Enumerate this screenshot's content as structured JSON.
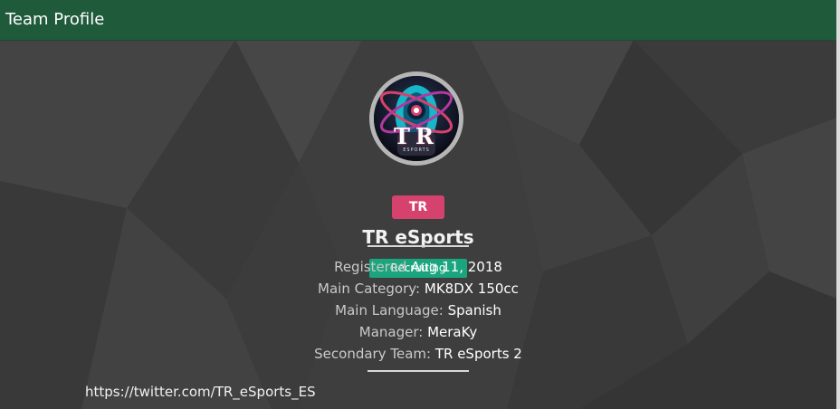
{
  "header": {
    "title": "Team Profile"
  },
  "team": {
    "tag": "TR",
    "name": "TR eSports",
    "status": "Recruiting",
    "logo_text": "TR",
    "logo_subtext": "ESPORTS"
  },
  "details": [
    {
      "label": "Registered",
      "value": "Aug 11, 2018"
    },
    {
      "label": "Main Category:",
      "value": "MK8DX 150cc"
    },
    {
      "label": "Main Language:",
      "value": "Spanish"
    },
    {
      "label": "Manager:",
      "value": "MeraKy"
    },
    {
      "label": "Secondary Team:",
      "value": "TR eSports 2"
    }
  ],
  "link": {
    "text": "https://twitter.com/TR_eSports_ES"
  },
  "colors": {
    "header_bg": "#1f5a3b",
    "tag_bg": "#d6426e",
    "status_bg": "#1aa57f",
    "page_bg": "#3e3e3e"
  },
  "icons": {
    "logo": "team-logo-icon"
  }
}
